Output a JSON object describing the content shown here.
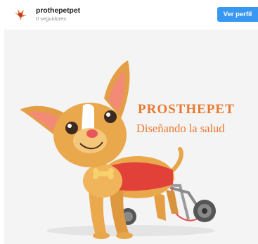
{
  "profile": {
    "username": "prothepetpet",
    "followers": "0 seguidores",
    "follow_button": "Ver perfil",
    "accent": "#3897f0"
  },
  "post": {
    "title": "PROSTHEPET",
    "subtitle": "Diseñando la salud",
    "text_color": "#e7782e",
    "image": "chihuahua-in-wheelchair-illustration"
  }
}
